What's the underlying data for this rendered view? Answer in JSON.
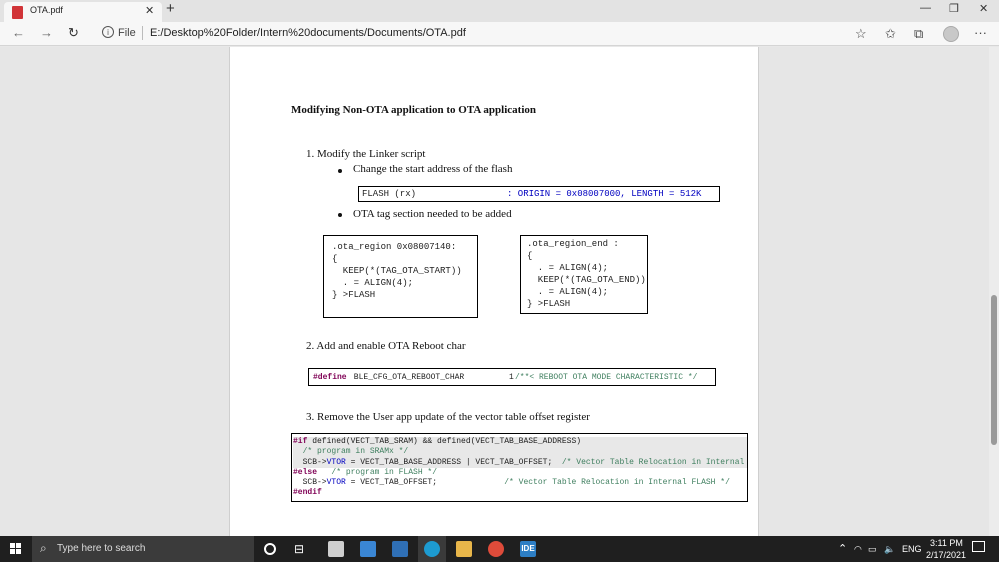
{
  "browser": {
    "tab_title": "OTA.pdf",
    "tab_close": "✕",
    "new_tab": "+",
    "window_controls": [
      "—",
      "❐",
      "✕"
    ],
    "scheme_label": "File",
    "url": "E:/Desktop%20Folder/Intern%20documents/Documents/OTA.pdf",
    "more_label": "···"
  },
  "doc": {
    "heading": "Modifying Non-OTA application to OTA application",
    "step1": "1.   Modify the Linker script",
    "bullet1": "Change the start address of the flash",
    "flash_left": "FLASH (rx)",
    "flash_right": ": ORIGIN = 0x08007000, LENGTH = 512K",
    "bullet2": "OTA tag section needed to be added",
    "ota_region_code": ".ota_region 0x08007140:\n{\n  KEEP(*(TAG_OTA_START))\n  . = ALIGN(4);\n} >FLASH",
    "ota_region_end_code": ".ota_region_end :\n{\n  . = ALIGN(4);\n  KEEP(*(TAG_OTA_END))\n  . = ALIGN(4);\n} >FLASH",
    "step2": "2.   Add and enable OTA Reboot char",
    "define_kw": "#define",
    "define_name": " BLE_CFG_OTA_REBOOT_CHAR",
    "define_value": "1",
    "define_comment": "/**< REBOOT OTA MODE CHARACTERISTIC */",
    "step3": "3.   Remove the User app update of the vector table offset register",
    "code3": {
      "if_kw": "#if",
      "if_rest": " defined(VECT_TAB_SRAM) && defined(VECT_TAB_BASE_ADDRESS)",
      "c1": "  /* program in SRAMx */",
      "l3a": "  SCB->",
      "l3b": "VTOR",
      "l3c": " = VECT_TAB_BASE_ADDRESS | VECT_TAB_OFFSET;  ",
      "c3": "/* Vector Table Relocation in Internal SRAMx",
      "else_kw": "#else",
      "c4": "   /* program in FLASH */",
      "l5a": "  SCB->",
      "l5b": "VTOR",
      "l5c": " = VECT_TAB_OFFSET;              ",
      "c5": "/* Vector Table Relocation in Internal FLASH */",
      "endif_kw": "#endif"
    }
  },
  "taskbar": {
    "search_placeholder": "Type here to search",
    "ide_label": "IDE",
    "language": "ENG",
    "time": "3:11 PM",
    "date": "2/17/2021"
  }
}
